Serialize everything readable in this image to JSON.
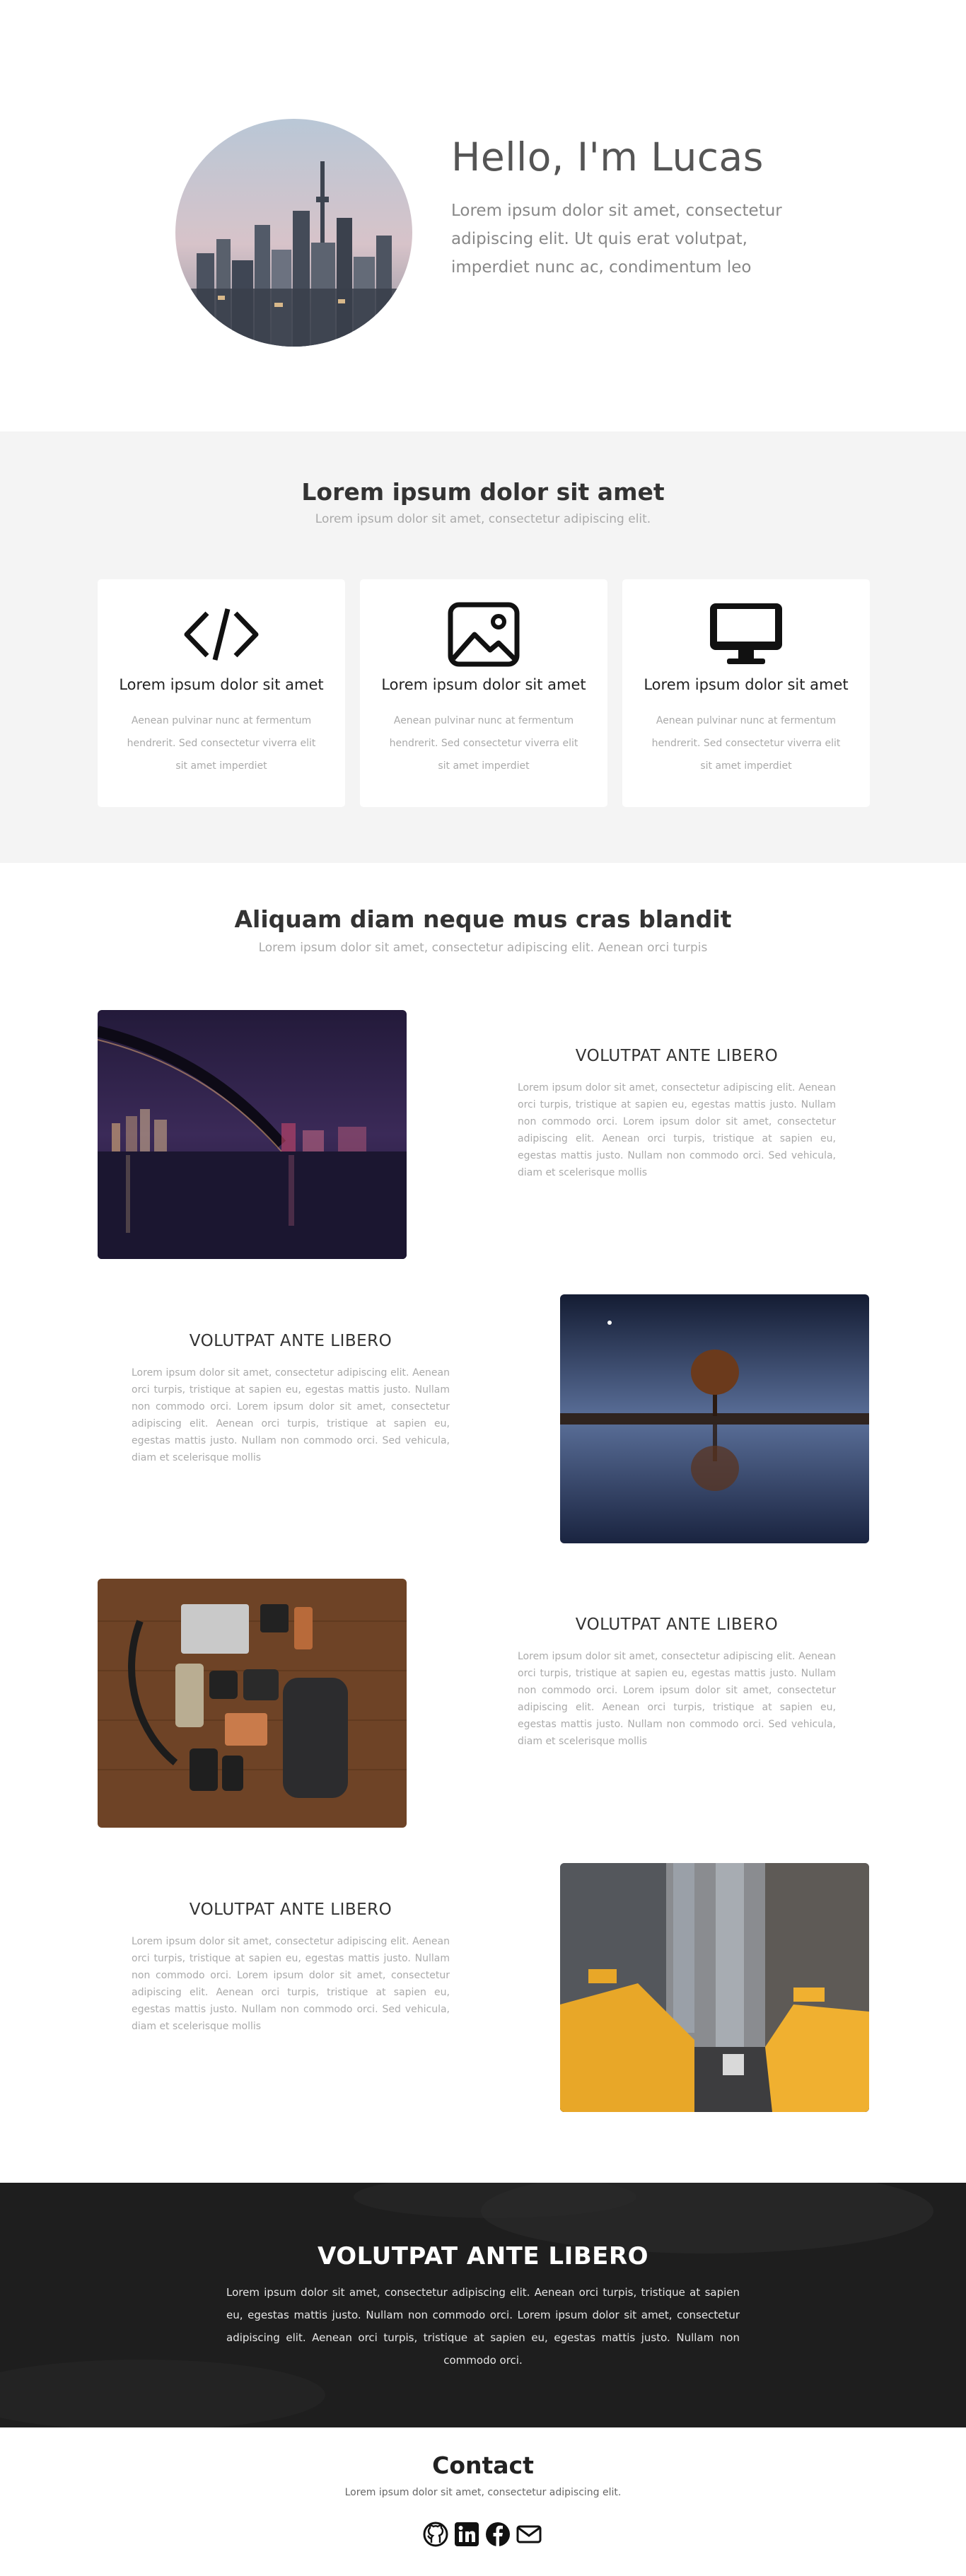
{
  "nav": {
    "menu_icon": "hamburger-menu-icon"
  },
  "hero": {
    "title": "Hello, I'm Lucas",
    "text": "Lorem ipsum dolor sit amet, consectetur adipiscing elit. Ut quis erat volutpat, imperdiet nunc ac, condimentum leo"
  },
  "services": {
    "title": "Lorem ipsum dolor sit amet",
    "subtitle": "Lorem ipsum dolor sit amet, consectetur adipiscing elit.",
    "cards": [
      {
        "icon": "code-icon",
        "title": "Lorem ipsum dolor sit amet",
        "text": "Aenean pulvinar nunc at fermentum hendrerit. Sed consectetur viverra elit sit amet imperdiet"
      },
      {
        "icon": "image-icon",
        "title": "Lorem ipsum dolor sit amet",
        "text": "Aenean pulvinar nunc at fermentum hendrerit. Sed consectetur viverra elit sit amet imperdiet"
      },
      {
        "icon": "desktop-icon",
        "title": "Lorem ipsum dolor sit amet",
        "text": "Aenean pulvinar nunc at fermentum hendrerit. Sed consectetur viverra elit sit amet imperdiet"
      }
    ]
  },
  "features": {
    "title": "Aliquam diam neque mus cras blandit",
    "subtitle": "Lorem ipsum dolor sit amet, consectetur adipiscing elit. Aenean orci turpis",
    "items": [
      {
        "title": "VOLUTPAT ANTE LIBERO",
        "text": "Lorem ipsum dolor sit amet, consectetur adipiscing elit. Aenean orci turpis, tristique at sapien eu, egestas mattis justo. Nullam non commodo orci. Lorem ipsum dolor sit amet, consectetur adipiscing elit. Aenean orci turpis, tristique at sapien eu, egestas mattis justo. Nullam non commodo orci. Sed vehicula, diam et scelerisque mollis",
        "image": "city-bridge-night-photo"
      },
      {
        "title": "VOLUTPAT ANTE LIBERO",
        "text": "Lorem ipsum dolor sit amet, consectetur adipiscing elit. Aenean orci turpis, tristique at sapien eu, egestas mattis justo. Nullam non commodo orci. Lorem ipsum dolor sit amet, consectetur adipiscing elit. Aenean orci turpis, tristique at sapien eu, egestas mattis justo. Nullam non commodo orci. Sed vehicula, diam et scelerisque mollis",
        "image": "tree-reflection-night-photo"
      },
      {
        "title": "VOLUTPAT ANTE LIBERO",
        "text": "Lorem ipsum dolor sit amet, consectetur adipiscing elit. Aenean orci turpis, tristique at sapien eu, egestas mattis justo. Nullam non commodo orci. Lorem ipsum dolor sit amet, consectetur adipiscing elit. Aenean orci turpis, tristique at sapien eu, egestas mattis justo. Nullam non commodo orci. Sed vehicula, diam et scelerisque mollis",
        "image": "camera-gear-flatlay-photo"
      },
      {
        "title": "VOLUTPAT ANTE LIBERO",
        "text": "Lorem ipsum dolor sit amet, consectetur adipiscing elit. Aenean orci turpis, tristique at sapien eu, egestas mattis justo. Nullam non commodo orci. Lorem ipsum dolor sit amet, consectetur adipiscing elit. Aenean orci turpis, tristique at sapien eu, egestas mattis justo. Nullam non commodo orci. Sed vehicula, diam et scelerisque mollis",
        "image": "taxi-street-photo"
      }
    ]
  },
  "banner": {
    "title": "VOLUTPAT ANTE LIBERO",
    "text": "Lorem ipsum dolor sit amet, consectetur adipiscing elit. Aenean orci turpis, tristique at sapien eu, egestas mattis justo. Nullam non commodo orci. Lorem ipsum dolor sit amet, consectetur adipiscing elit. Aenean orci turpis, tristique at sapien eu, egestas mattis justo. Nullam non commodo orci."
  },
  "contact": {
    "title": "Contact",
    "subtitle": "Lorem ipsum dolor sit amet, consectetur adipiscing elit.",
    "socials": [
      "github-icon",
      "linkedin-icon",
      "facebook-icon",
      "email-icon"
    ]
  },
  "colors": {
    "section_gray": "#f4f4f4",
    "banner_dark": "#1e1e1e",
    "heading": "#555555",
    "muted_text": "#aaaaaa"
  }
}
